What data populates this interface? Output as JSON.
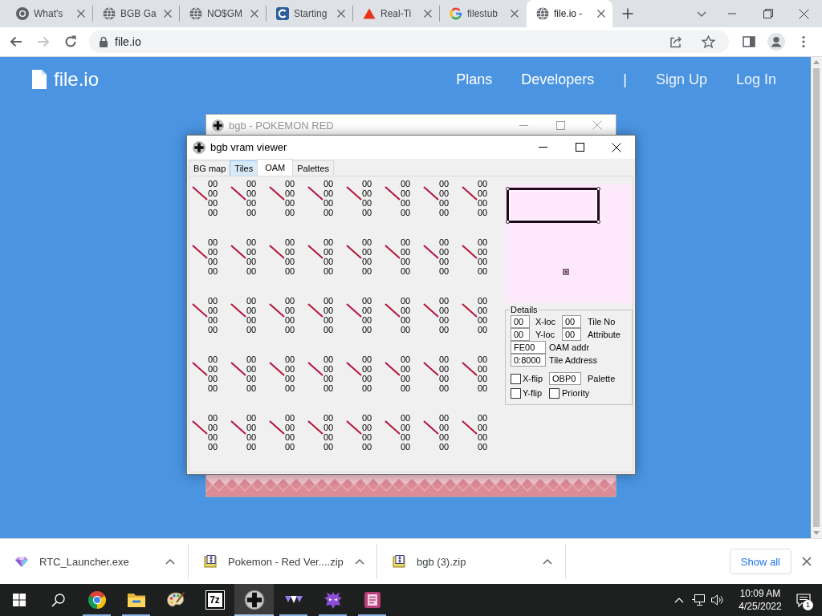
{
  "browser": {
    "tabs": [
      {
        "title": "What's",
        "kind": "ring",
        "selected": false
      },
      {
        "title": "BGB Ga",
        "kind": "globe",
        "selected": false
      },
      {
        "title": "NO$GM",
        "kind": "globe",
        "selected": false
      },
      {
        "title": "Starting",
        "kind": "c-logo",
        "selected": false
      },
      {
        "title": "Real-Ti",
        "kind": "triangle",
        "selected": false
      },
      {
        "title": "filestub",
        "kind": "g-logo",
        "selected": false
      },
      {
        "title": "file.io -",
        "kind": "globe",
        "selected": true
      }
    ],
    "nav_buttons": [
      {
        "kind": "back",
        "disabled": false
      },
      {
        "kind": "forward",
        "disabled": true
      },
      {
        "kind": "reload",
        "disabled": false
      }
    ],
    "address": "file.io"
  },
  "site": {
    "logo": "file.io",
    "nav_links": [
      "Plans",
      "Developers"
    ],
    "nav_separator": "|",
    "account_links": [
      "Sign Up",
      "Log In"
    ]
  },
  "emulator_window": {
    "title": "bgb - POKEMON RED",
    "active": false
  },
  "vram_viewer": {
    "title": "bgb vram viewer",
    "active": true,
    "tabs": [
      {
        "label": "BG map",
        "selected": false,
        "hovered": false
      },
      {
        "label": "Tiles",
        "selected": false,
        "hovered": true
      },
      {
        "label": "OAM",
        "selected": true,
        "hovered": false
      },
      {
        "label": "Palettes",
        "selected": false,
        "hovered": false
      }
    ],
    "oam_entries": [
      [
        "00",
        "00",
        "00",
        "00"
      ],
      [
        "00",
        "00",
        "00",
        "00"
      ],
      [
        "00",
        "00",
        "00",
        "00"
      ],
      [
        "00",
        "00",
        "00",
        "00"
      ],
      [
        "00",
        "00",
        "00",
        "00"
      ],
      [
        "00",
        "00",
        "00",
        "00"
      ],
      [
        "00",
        "00",
        "00",
        "00"
      ],
      [
        "00",
        "00",
        "00",
        "00"
      ],
      [
        "00",
        "00",
        "00",
        "00"
      ],
      [
        "00",
        "00",
        "00",
        "00"
      ],
      [
        "00",
        "00",
        "00",
        "00"
      ],
      [
        "00",
        "00",
        "00",
        "00"
      ],
      [
        "00",
        "00",
        "00",
        "00"
      ],
      [
        "00",
        "00",
        "00",
        "00"
      ],
      [
        "00",
        "00",
        "00",
        "00"
      ],
      [
        "00",
        "00",
        "00",
        "00"
      ],
      [
        "00",
        "00",
        "00",
        "00"
      ],
      [
        "00",
        "00",
        "00",
        "00"
      ],
      [
        "00",
        "00",
        "00",
        "00"
      ],
      [
        "00",
        "00",
        "00",
        "00"
      ],
      [
        "00",
        "00",
        "00",
        "00"
      ],
      [
        "00",
        "00",
        "00",
        "00"
      ],
      [
        "00",
        "00",
        "00",
        "00"
      ],
      [
        "00",
        "00",
        "00",
        "00"
      ],
      [
        "00",
        "00",
        "00",
        "00"
      ],
      [
        "00",
        "00",
        "00",
        "00"
      ],
      [
        "00",
        "00",
        "00",
        "00"
      ],
      [
        "00",
        "00",
        "00",
        "00"
      ],
      [
        "00",
        "00",
        "00",
        "00"
      ],
      [
        "00",
        "00",
        "00",
        "00"
      ],
      [
        "00",
        "00",
        "00",
        "00"
      ],
      [
        "00",
        "00",
        "00",
        "00"
      ],
      [
        "00",
        "00",
        "00",
        "00"
      ],
      [
        "00",
        "00",
        "00",
        "00"
      ],
      [
        "00",
        "00",
        "00",
        "00"
      ],
      [
        "00",
        "00",
        "00",
        "00"
      ],
      [
        "00",
        "00",
        "00",
        "00"
      ],
      [
        "00",
        "00",
        "00",
        "00"
      ],
      [
        "00",
        "00",
        "00",
        "00"
      ],
      [
        "00",
        "00",
        "00",
        "00"
      ]
    ],
    "details": {
      "title": "Details",
      "x_loc": {
        "value": "00",
        "label": "X-loc"
      },
      "tile_no": {
        "value": "00",
        "label": "Tile No"
      },
      "y_loc": {
        "value": "00",
        "label": "Y-loc"
      },
      "attribute": {
        "value": "00",
        "label": "Attribute"
      },
      "oam_addr": {
        "value": "FE00",
        "label": "OAM addr"
      },
      "tile_address": {
        "value": "0:8000",
        "label": "Tile Address"
      },
      "x_flip": {
        "label": "X-flip",
        "checked": false
      },
      "palette": {
        "value": "OBP0",
        "label": "Palette"
      },
      "y_flip": {
        "label": "Y-flip",
        "checked": false
      },
      "priority": {
        "label": "Priority",
        "checked": false
      }
    }
  },
  "downloads": {
    "items": [
      {
        "name": "RTC_Launcher.exe",
        "kind": "exe"
      },
      {
        "name": "Pokemon - Red Ver....zip",
        "kind": "zip"
      },
      {
        "name": "bgb (3).zip",
        "kind": "zip"
      }
    ],
    "show_all": "Show all"
  },
  "taskbar": {
    "apps": [
      {
        "kind": "ring",
        "running": true,
        "selected": false
      },
      {
        "kind": "folder",
        "running": true,
        "selected": false
      },
      {
        "kind": "paint",
        "running": false,
        "selected": false
      },
      {
        "kind": "archiver",
        "label": "7z",
        "running": false,
        "selected": false
      },
      {
        "kind": "dpad",
        "running": true,
        "selected": true
      },
      {
        "kind": "triangles",
        "running": true,
        "selected": false
      },
      {
        "kind": "horned",
        "running": true,
        "selected": false
      },
      {
        "kind": "lines",
        "running": true,
        "selected": false
      }
    ],
    "time": "10:09 AM",
    "date": "4/25/2022",
    "notifications": "1"
  }
}
